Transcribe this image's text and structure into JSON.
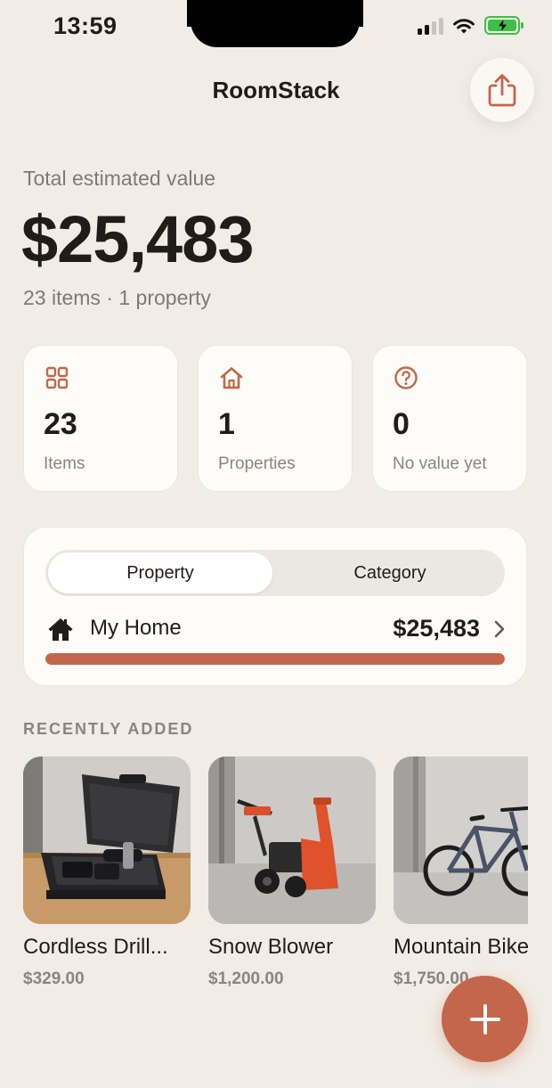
{
  "status_bar": {
    "time": "13:59"
  },
  "header": {
    "title": "RoomStack"
  },
  "summary": {
    "label": "Total estimated value",
    "total": "$25,483",
    "meta": "23 items · 1 property"
  },
  "stats": [
    {
      "number": "23",
      "label": "Items",
      "icon": "grid-icon"
    },
    {
      "number": "1",
      "label": "Properties",
      "icon": "house-icon"
    },
    {
      "number": "0",
      "label": "No value yet",
      "icon": "question-circle-icon"
    }
  ],
  "breakdown": {
    "tabs": [
      "Property",
      "Category"
    ],
    "selected_tab": "Property",
    "rows": [
      {
        "name": "My Home",
        "value": "$25,483",
        "share": 1.0
      }
    ]
  },
  "recent": {
    "title": "RECENTLY ADDED",
    "items": [
      {
        "name": "Cordless Drill...",
        "price": "$329.00"
      },
      {
        "name": "Snow Blower",
        "price": "$1,200.00"
      },
      {
        "name": "Mountain Bike",
        "price": "$1,750.00"
      }
    ]
  },
  "colors": {
    "accent": "#c4664b",
    "background": "#f1ede6",
    "card": "#fefcf9"
  }
}
